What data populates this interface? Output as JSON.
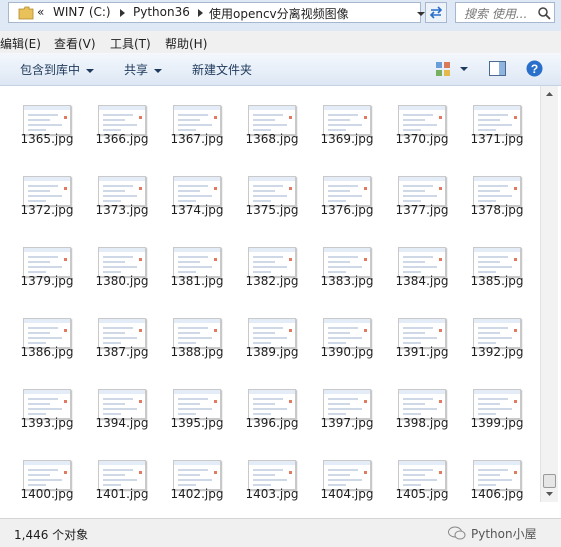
{
  "address": {
    "overflow_glyph": "«",
    "crumbs": [
      "WIN7 (C:)",
      "Python36",
      "使用opencv分离视频图像"
    ],
    "search_placeholder": "搜索 使用..."
  },
  "menu": [
    "编辑(E)",
    "查看(V)",
    "工具(T)",
    "帮助(H)"
  ],
  "toolbar": {
    "include_library": "包含到库中",
    "share": "共享",
    "new_folder": "新建文件夹"
  },
  "files": [
    [
      "1365.jpg",
      "1366.jpg",
      "1367.jpg",
      "1368.jpg",
      "1369.jpg",
      "1370.jpg",
      "1371.jpg"
    ],
    [
      "1372.jpg",
      "1373.jpg",
      "1374.jpg",
      "1375.jpg",
      "1376.jpg",
      "1377.jpg",
      "1378.jpg"
    ],
    [
      "1379.jpg",
      "1380.jpg",
      "1381.jpg",
      "1382.jpg",
      "1383.jpg",
      "1384.jpg",
      "1385.jpg"
    ],
    [
      "1386.jpg",
      "1387.jpg",
      "1388.jpg",
      "1389.jpg",
      "1390.jpg",
      "1391.jpg",
      "1392.jpg"
    ],
    [
      "1393.jpg",
      "1394.jpg",
      "1395.jpg",
      "1396.jpg",
      "1397.jpg",
      "1398.jpg",
      "1399.jpg"
    ],
    [
      "1400.jpg",
      "1401.jpg",
      "1402.jpg",
      "1403.jpg",
      "1404.jpg",
      "1405.jpg",
      "1406.jpg"
    ]
  ],
  "status": {
    "count": "1,446 个对象"
  },
  "watermark": "Python小屋",
  "colors": {
    "folder": "#e8c15a",
    "accent": "#1e395b",
    "help": "#2a6fc9"
  }
}
